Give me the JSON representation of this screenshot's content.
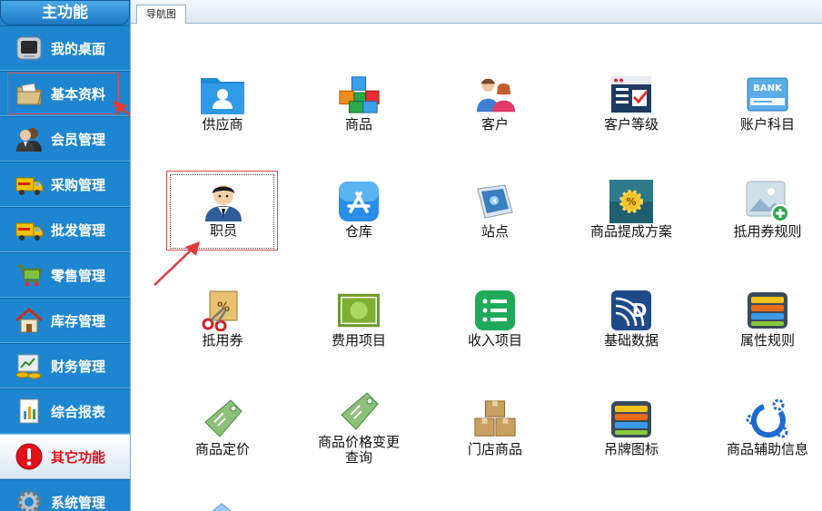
{
  "sidebar": {
    "title": "主功能",
    "items": [
      {
        "label": "我的桌面",
        "icon": "monitor-icon"
      },
      {
        "label": "基本资料",
        "icon": "folder-icon"
      },
      {
        "label": "会员管理",
        "icon": "members-icon"
      },
      {
        "label": "采购管理",
        "icon": "truck-icon"
      },
      {
        "label": "批发管理",
        "icon": "truck-icon"
      },
      {
        "label": "零售管理",
        "icon": "cart-icon"
      },
      {
        "label": "库存管理",
        "icon": "house-icon"
      },
      {
        "label": "财务管理",
        "icon": "finance-icon"
      },
      {
        "label": "综合报表",
        "icon": "report-icon"
      },
      {
        "label": "其它功能",
        "icon": "alert-icon",
        "active": true
      },
      {
        "label": "系统管理",
        "icon": "gear-icon"
      }
    ]
  },
  "tabs": [
    {
      "label": "导航图"
    }
  ],
  "tiles": [
    {
      "label": "供应商",
      "icon": "folder-user-icon"
    },
    {
      "label": "商品",
      "icon": "cubes-icon"
    },
    {
      "label": "客户",
      "icon": "customers-icon"
    },
    {
      "label": "客户等级",
      "icon": "checklist-icon"
    },
    {
      "label": "账户科目",
      "icon": "bank-card-icon"
    },
    {
      "label": "职员",
      "icon": "employee-icon",
      "selected": true
    },
    {
      "label": "仓库",
      "icon": "appstore-icon"
    },
    {
      "label": "站点",
      "icon": "station-icon"
    },
    {
      "label": "商品提成方案",
      "icon": "commission-icon"
    },
    {
      "label": "抵用券规则",
      "icon": "image-add-icon"
    },
    {
      "label": "抵用券",
      "icon": "coupon-scissors-icon"
    },
    {
      "label": "费用项目",
      "icon": "expense-icon"
    },
    {
      "label": "收入项目",
      "icon": "income-list-icon"
    },
    {
      "label": "基础数据",
      "icon": "data-d-icon"
    },
    {
      "label": "属性规则",
      "icon": "stack-icon"
    },
    {
      "label": "商品定价",
      "icon": "price-tag-icon"
    },
    {
      "label": "商品价格变更查询",
      "icon": "price-tag-icon"
    },
    {
      "label": "门店商品",
      "icon": "boxes-icon"
    },
    {
      "label": "吊牌图标",
      "icon": "stack-icon"
    },
    {
      "label": "商品辅助信息",
      "icon": "gears-icon"
    }
  ]
}
